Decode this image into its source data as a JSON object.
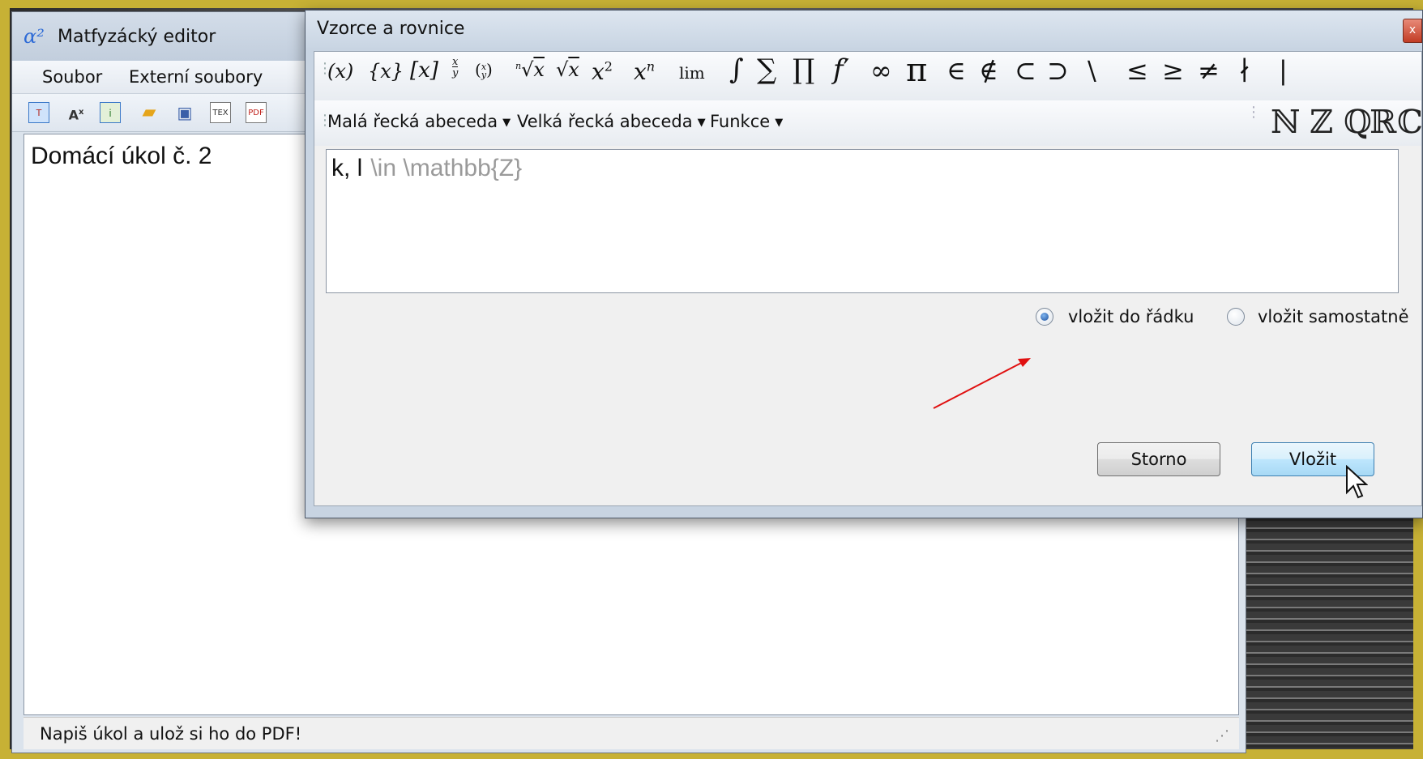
{
  "main_window": {
    "title": "Matfyzácký editor",
    "menu": [
      "Soubor",
      "Externí soubory"
    ],
    "toolbar_icons": [
      "table-icon",
      "superscript-icon",
      "info-icon",
      "open-folder-icon",
      "save-icon",
      "tex-export-icon",
      "pdf-export-icon"
    ],
    "document_text": "Domácí úkol č. 2",
    "status_text": "Napiš úkol a ulož si ho do PDF!"
  },
  "dialog": {
    "title": "Vzorce a rovnice",
    "close_label": "x",
    "math_buttons": [
      "(x)",
      "{x}",
      "[x]",
      "x/y",
      "binom",
      "n-th root",
      "sqrt",
      "x²",
      "xⁿ",
      "lim",
      "∫",
      "∑",
      "∏",
      "f′",
      "∞",
      "π",
      "∈",
      "∉",
      "⊂",
      "⊃",
      "\\",
      "≤",
      "≥",
      "≠",
      "∤",
      "|"
    ],
    "dropdowns": [
      "Malá řecká abeceda",
      "Velká řecká abeceda",
      "Funkce"
    ],
    "set_buttons": [
      "ℕ",
      "ℤ",
      "ℚ",
      "ℝ",
      "ℂ"
    ],
    "input": {
      "typed": "k, l",
      "hint": "\\in  \\mathbb{Z}"
    },
    "radio_inline": {
      "label": "vložit do řádku",
      "checked": true
    },
    "radio_separate": {
      "label": "vložit samostatně",
      "checked": false
    },
    "cancel_label": "Storno",
    "insert_label": "Vložit"
  },
  "colors": {
    "annotation_arrow": "#e01010",
    "desktop_border": "#c7b135"
  }
}
